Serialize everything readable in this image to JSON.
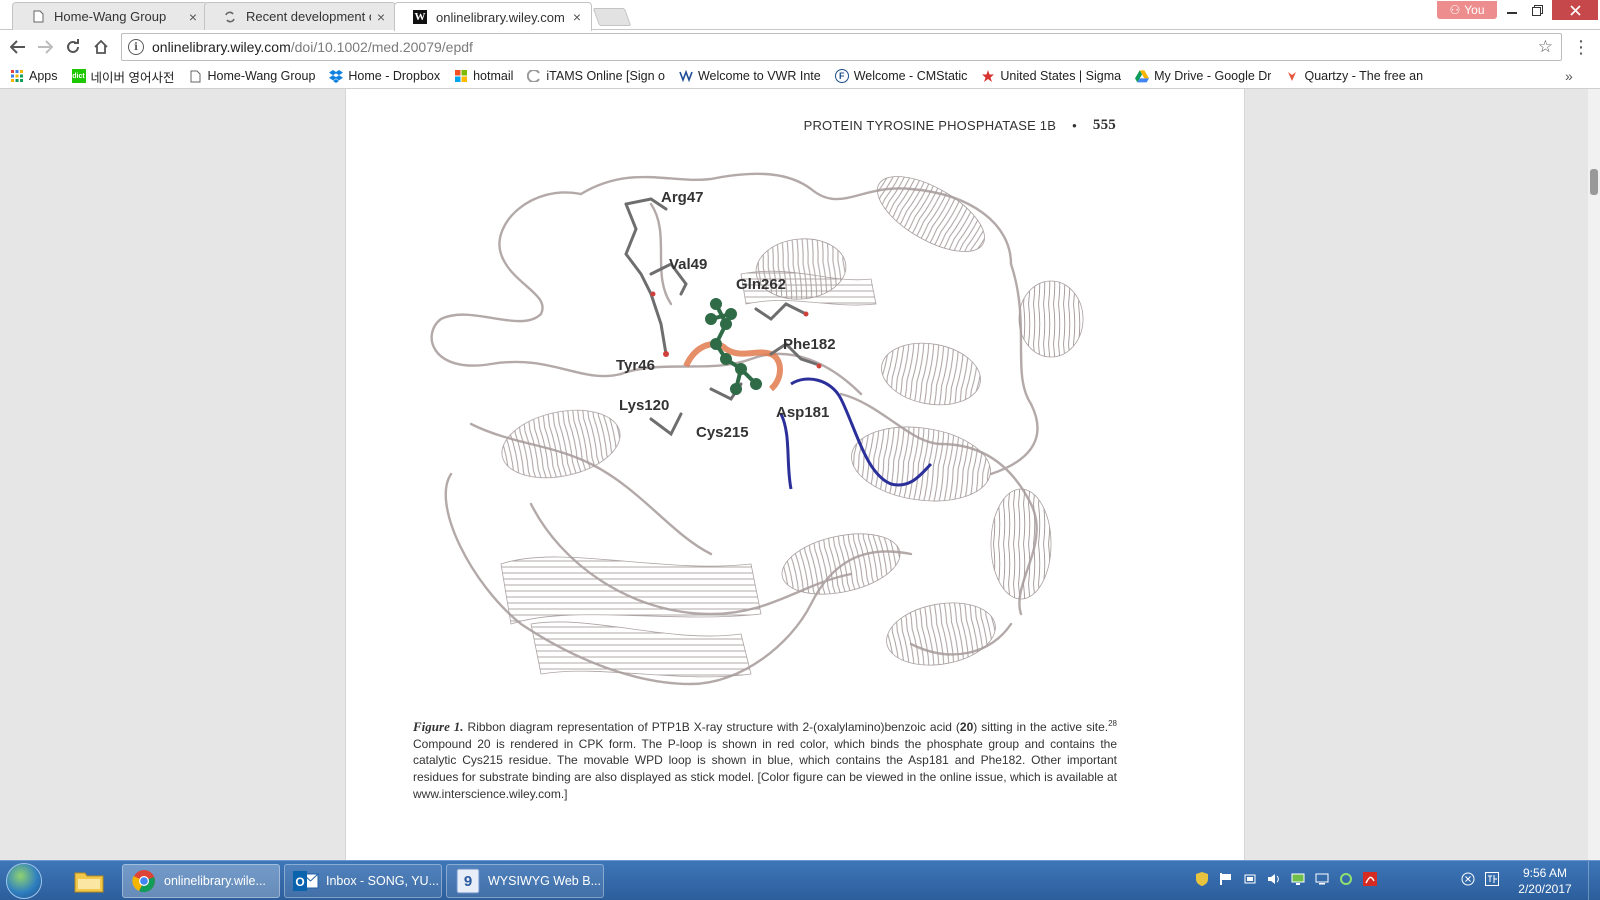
{
  "browser": {
    "tabs": [
      {
        "title": "Home-Wang Group",
        "icon": "page-icon",
        "close": "×"
      },
      {
        "title": "Recent development of s",
        "icon": "loading-icon",
        "close": "×"
      },
      {
        "title": "onlinelibrary.wiley.com",
        "icon": "wiley-favicon",
        "close": "×"
      }
    ],
    "profile_label": "You",
    "address": {
      "host": "onlinelibrary.wiley.com",
      "path": "/doi/10.1002/med.20079/epdf"
    },
    "bookmarks": [
      {
        "label": "Apps",
        "icon": "apps-grid-icon"
      },
      {
        "label": "네이버 영어사전",
        "icon": "naver-dict-icon"
      },
      {
        "label": "Home-Wang Group",
        "icon": "page-icon"
      },
      {
        "label": "Home - Dropbox",
        "icon": "dropbox-icon"
      },
      {
        "label": "hotmail",
        "icon": "windows-icon"
      },
      {
        "label": "iTAMS Online [Sign o",
        "icon": "itams-icon"
      },
      {
        "label": "Welcome to VWR Inte",
        "icon": "vwr-icon"
      },
      {
        "label": "Welcome - CMStatic",
        "icon": "cms-icon"
      },
      {
        "label": "United States | Sigma",
        "icon": "sigma-icon"
      },
      {
        "label": "My Drive - Google Dr",
        "icon": "google-drive-icon"
      },
      {
        "label": "Quartzy - The free an",
        "icon": "quartzy-icon"
      }
    ],
    "bookmarks_overflow": "»"
  },
  "document": {
    "running_head": "PROTEIN TYROSINE PHOSPHATASE 1B",
    "bullet": "•",
    "page_number": "555",
    "residue_labels": [
      "Arg47",
      "Val49",
      "Gln262",
      "Phe182",
      "Tyr46",
      "Lys120",
      "Asp181",
      "Cys215"
    ],
    "caption": {
      "label": "Figure 1.",
      "part1": "Ribbon diagram representation of PTP1B X-ray structure with 2-(oxalylamino)benzoic acid (",
      "compound": "20",
      "part2": ") sitting in the active site.",
      "ref": "28",
      "part3": " Compound 20 is rendered in CPK form. The P-loop is shown in red color, which binds the phosphate group and contains the catalytic Cys215 residue. The movable WPD loop is shown in blue, which contains the Asp181 and Phe182. Other important residues for substrate binding are also displayed as stick model. [Color figure can be viewed in the online issue, which is available at www.interscience.wiley.com.]"
    }
  },
  "taskbar": {
    "buttons": [
      {
        "label": "onlinelibrary.wile...",
        "icon": "chrome-icon"
      },
      {
        "label": "Inbox - SONG, YU...",
        "icon": "outlook-icon"
      },
      {
        "label": "WYSIWYG Web B...",
        "icon": "wysiwyg-icon"
      }
    ],
    "time": "9:56 AM",
    "date": "2/20/2017"
  },
  "colors": {
    "ribbon": "#b4a9a9",
    "p_loop": "#e07a4e",
    "wpd_loop": "#2b2f9a",
    "ligand": "#2f6b46",
    "taskbar": "#3467a8"
  }
}
